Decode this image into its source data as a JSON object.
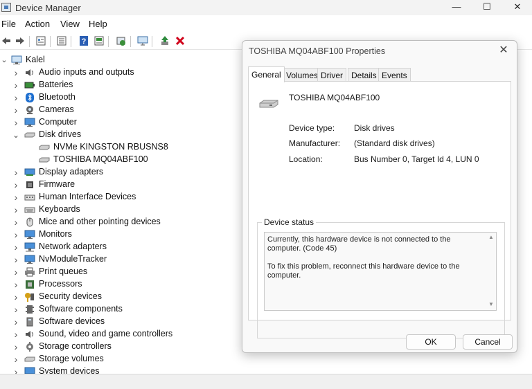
{
  "window": {
    "title": "Device Manager",
    "controls": {
      "minimize": "—",
      "maximize": "☐",
      "close": "✕"
    }
  },
  "menu": [
    "File",
    "Action",
    "View",
    "Help"
  ],
  "toolbar": {
    "icons": [
      "back-icon",
      "forward-icon",
      "properties-icon",
      "list-icon",
      "help-icon",
      "show-hidden-icon",
      "update-driver-icon",
      "scan-icon",
      "enable-icon",
      "uninstall-icon"
    ],
    "colors": {
      "uninstall": "#d0021b",
      "enable": "#2e8b3e",
      "help": "#2b5fb4"
    }
  },
  "tree": {
    "root": "Kalel",
    "categories": [
      {
        "label": "Audio inputs and outputs",
        "icon": "speaker-icon",
        "expanded": false
      },
      {
        "label": "Batteries",
        "icon": "battery-icon",
        "expanded": false
      },
      {
        "label": "Bluetooth",
        "icon": "bluetooth-icon",
        "expanded": false
      },
      {
        "label": "Cameras",
        "icon": "camera-icon",
        "expanded": false
      },
      {
        "label": "Computer",
        "icon": "monitor-icon",
        "expanded": false
      },
      {
        "label": "Disk drives",
        "icon": "disk-icon",
        "expanded": true
      },
      {
        "label": "NVMe KINGSTON RBUSNS8",
        "icon": "disk-icon",
        "child": true
      },
      {
        "label": "TOSHIBA MQ04ABF100",
        "icon": "disk-icon",
        "child": true
      },
      {
        "label": "Display adapters",
        "icon": "display-adapter-icon",
        "expanded": false
      },
      {
        "label": "Firmware",
        "icon": "chip-icon",
        "expanded": false
      },
      {
        "label": "Human Interface Devices",
        "icon": "hid-icon",
        "expanded": false
      },
      {
        "label": "Keyboards",
        "icon": "keyboard-icon",
        "expanded": false
      },
      {
        "label": "Mice and other pointing devices",
        "icon": "mouse-icon",
        "expanded": false
      },
      {
        "label": "Monitors",
        "icon": "monitor-icon",
        "expanded": false
      },
      {
        "label": "Network adapters",
        "icon": "network-icon",
        "expanded": false
      },
      {
        "label": "NvModuleTracker",
        "icon": "monitor-icon",
        "expanded": false
      },
      {
        "label": "Print queues",
        "icon": "printer-icon",
        "expanded": false
      },
      {
        "label": "Processors",
        "icon": "processor-icon",
        "expanded": false
      },
      {
        "label": "Security devices",
        "icon": "key-icon",
        "expanded": false
      },
      {
        "label": "Software components",
        "icon": "component-icon",
        "expanded": false
      },
      {
        "label": "Software devices",
        "icon": "software-device-icon",
        "expanded": false
      },
      {
        "label": "Sound, video and game controllers",
        "icon": "speaker-icon",
        "expanded": false
      },
      {
        "label": "Storage controllers",
        "icon": "gear-icon",
        "expanded": false
      },
      {
        "label": "Storage volumes",
        "icon": "disk-icon",
        "expanded": false
      },
      {
        "label": "System devices",
        "icon": "computer-icon",
        "expanded": false
      }
    ]
  },
  "dialog": {
    "title": "TOSHIBA MQ04ABF100 Properties",
    "close": "✕",
    "tabs": [
      "General",
      "Volumes",
      "Driver",
      "Details",
      "Events"
    ],
    "active_tab": "General",
    "device_name": "TOSHIBA MQ04ABF100",
    "properties": [
      {
        "label": "Device type:",
        "value": "Disk drives"
      },
      {
        "label": "Manufacturer:",
        "value": "(Standard disk drives)"
      },
      {
        "label": "Location:",
        "value": "Bus Number 0, Target Id 4, LUN 0"
      }
    ],
    "status_group_title": "Device status",
    "status_text": "Currently, this hardware device is not connected to the computer. (Code 45)\n\nTo fix this problem, reconnect this hardware device to the computer.",
    "ok": "OK",
    "cancel": "Cancel"
  }
}
